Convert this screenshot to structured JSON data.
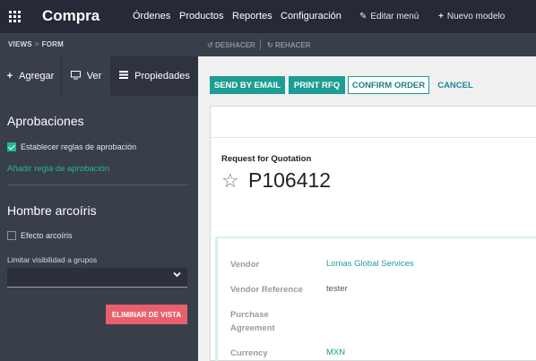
{
  "topbar": {
    "app_title": "Compra",
    "nav": [
      "Órdenes",
      "Productos",
      "Reportes",
      "Configuración"
    ],
    "edit_menu": "Editar menú",
    "new_model": "Nuevo modelo"
  },
  "subbar": {
    "breadcrumb": [
      "VIEWS",
      "FORM"
    ],
    "undo": "DESHACER",
    "redo": "REHACER"
  },
  "left": {
    "tabs": [
      {
        "label": "Agregar",
        "icon": "plus-icon"
      },
      {
        "label": "Ver",
        "icon": "monitor-icon"
      },
      {
        "label": "Propiedades",
        "icon": "list-icon"
      }
    ],
    "approvals_title": "Aprobaciones",
    "approval_rules_label": "Establecer reglas de aprobación",
    "approval_rules_checked": true,
    "add_rule_link": "Añadir regla de aprobación",
    "rainbow_title": "Hombre arcoíris",
    "rainbow_label": "Efecto arcoíris",
    "rainbow_checked": false,
    "visibility_label": "Limitar visibilidad a grupos",
    "visibility_value": "",
    "delete_view": "ELIMINAR DE VISTA"
  },
  "form": {
    "buttons": {
      "send_email": "SEND BY EMAIL",
      "print_rfq": "PRINT RFQ",
      "confirm": "CONFIRM ORDER",
      "cancel": "CANCEL"
    },
    "doc_type": "Request for Quotation",
    "doc_number": "P106412",
    "fields": [
      {
        "label": "Vendor",
        "value": "Lomas Global Services"
      },
      {
        "label": "Vendor Reference",
        "value": "tester"
      },
      {
        "label": "Purchase Agreement",
        "value": ""
      },
      {
        "label": "Currency",
        "value": "MXN"
      }
    ]
  },
  "colors": {
    "accent": "#1d9d93",
    "danger": "#e8606c",
    "topbar": "#262a36",
    "panel": "#393e4b"
  }
}
